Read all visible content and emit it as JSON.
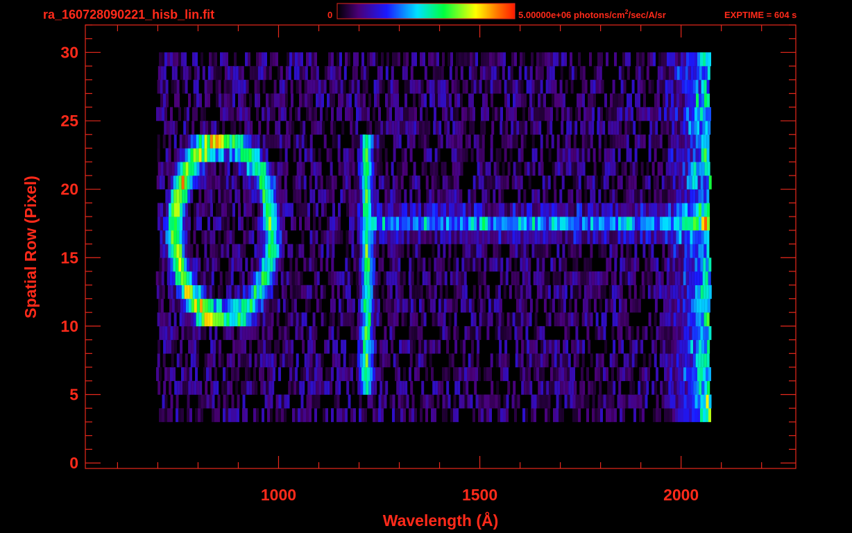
{
  "header": {
    "filename": "ra_160728090221_hisb_lin.fit",
    "colorbar_min": "0",
    "colorbar_max": "5.00000e+06",
    "colorbar_units_before": "photons/cm",
    "colorbar_units_sup": "2",
    "colorbar_units_after": "/sec/A/sr",
    "exptime": "EXPTIME = 604 s"
  },
  "colors": {
    "text": "#ff2a1a",
    "axis": "#e8291c",
    "background": "#000000"
  },
  "chart_data": {
    "type": "heatmap",
    "xlabel": "Wavelength (Å)",
    "ylabel": "Spatial Row (Pixel)",
    "xlim": [
      520,
      2285
    ],
    "ylim": [
      -0.4,
      32
    ],
    "xticks": [
      1000,
      1500,
      2000
    ],
    "xtick_labels": [
      "1000",
      "1500",
      "2000"
    ],
    "yticks": [
      0,
      5,
      10,
      15,
      20,
      25,
      30
    ],
    "ytick_labels": [
      "0",
      "5",
      "10",
      "15",
      "20",
      "25",
      "30"
    ],
    "colorbar_range": [
      0,
      5000000
    ],
    "colormap": "rainbow",
    "grid": false,
    "data_extent": {
      "x": [
        695,
        2070
      ],
      "y": [
        3,
        30
      ]
    },
    "noise_level": 0.22,
    "features": [
      {
        "kind": "ring",
        "label": "",
        "center_x": 860,
        "center_y": 17,
        "radius_x": 120,
        "radius_y": 6.5,
        "y_range": [
          10,
          24
        ],
        "peak_intensity": 0.65
      },
      {
        "kind": "vertical-line",
        "label": "",
        "x": 1216,
        "y_range": [
          5,
          24
        ],
        "peak_intensity": 0.48
      },
      {
        "kind": "horizontal-band",
        "label": "",
        "y": 17.5,
        "x_range": [
          1230,
          2070
        ],
        "peak_intensity": 0.32
      },
      {
        "kind": "edge-rise",
        "label": "",
        "x_range": [
          1920,
          2070
        ],
        "y_range": [
          2,
          30
        ],
        "peak_intensity": 0.5
      }
    ]
  }
}
